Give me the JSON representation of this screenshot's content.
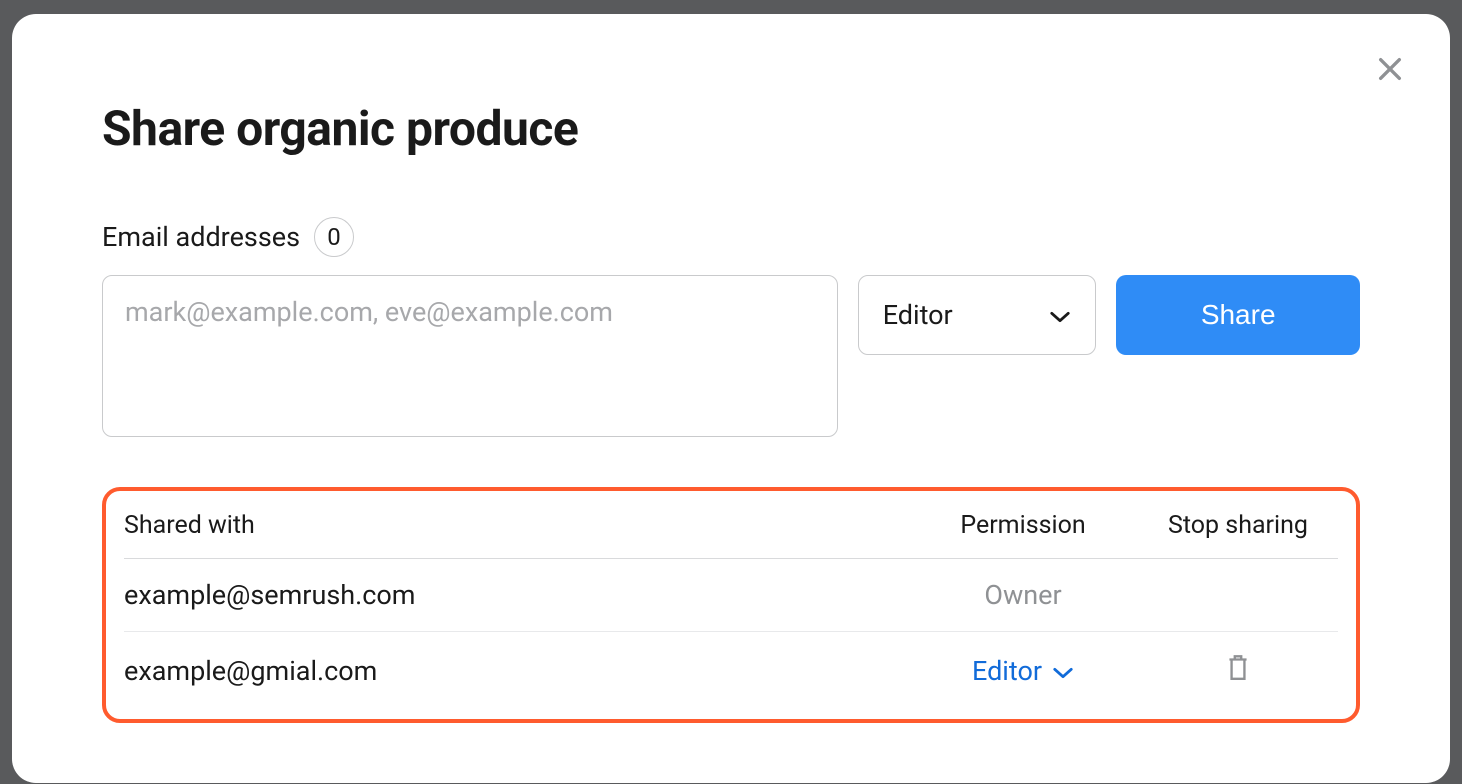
{
  "modal": {
    "title": "Share organic produce",
    "email_label": "Email addresses",
    "email_count": "0",
    "email_placeholder": "mark@example.com, eve@example.com",
    "role_selected": "Editor",
    "share_button": "Share"
  },
  "table": {
    "headers": {
      "shared_with": "Shared with",
      "permission": "Permission",
      "stop_sharing": "Stop sharing"
    },
    "rows": [
      {
        "email": "example@semrush.com",
        "permission": "Owner",
        "permission_type": "static",
        "removable": false
      },
      {
        "email": "example@gmial.com",
        "permission": "Editor",
        "permission_type": "dropdown",
        "removable": true
      }
    ]
  },
  "colors": {
    "accent_blue": "#2f8cf6",
    "link_blue": "#116bd9",
    "highlight_border": "#ff5b2e"
  }
}
